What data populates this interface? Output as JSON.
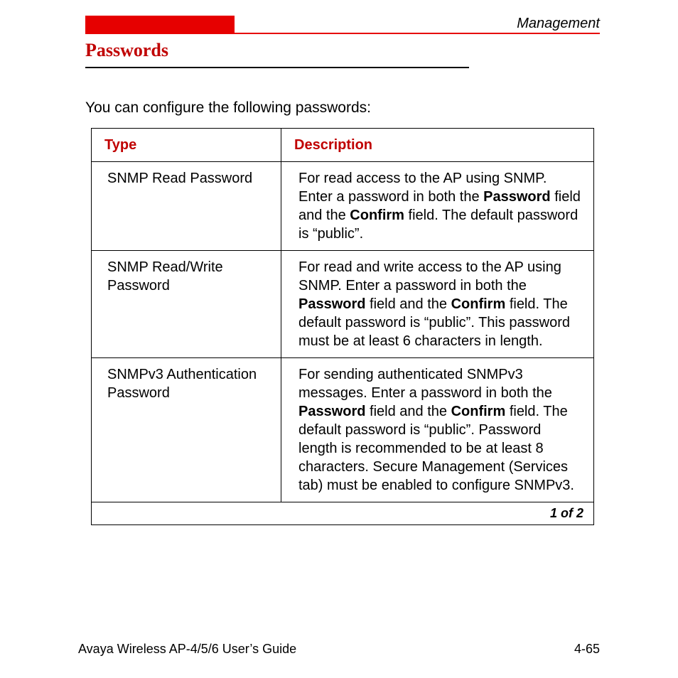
{
  "header": {
    "section": "Management"
  },
  "heading": "Passwords",
  "intro": "You can configure the following passwords:",
  "table": {
    "headers": [
      "Type",
      "Description"
    ],
    "rows": [
      {
        "type": "SNMP Read Password",
        "desc": {
          "p1": "For read access to the AP using SNMP. Enter a password in both the ",
          "b1": "Password",
          "p2": " field and the ",
          "b2": "Confirm",
          "p3": " field. The default password is “public”."
        }
      },
      {
        "type": "SNMP Read/Write Password",
        "desc": {
          "p1": "For read and write access to the AP using SNMP. Enter a password in both the ",
          "b1": "Password",
          "p2": " field and the ",
          "b2": "Confirm",
          "p3": " field. The default password is “public”. This password must be at least 6 characters in length."
        }
      },
      {
        "type": "SNMPv3 Authentication Password",
        "desc": {
          "p1": "For sending authenticated SNMPv3 messages. Enter a password in both the ",
          "b1": "Password",
          "p2": " field and the ",
          "b2": "Confirm",
          "p3": " field. The default password is “public”. Password length is recommended to be at least 8 characters. Secure Management (Services tab) must be enabled to configure SNMPv3."
        }
      }
    ],
    "pager": "1 of 2"
  },
  "footer": {
    "left": "Avaya Wireless AP-4/5/6 User’s Guide",
    "right": "4-65"
  }
}
